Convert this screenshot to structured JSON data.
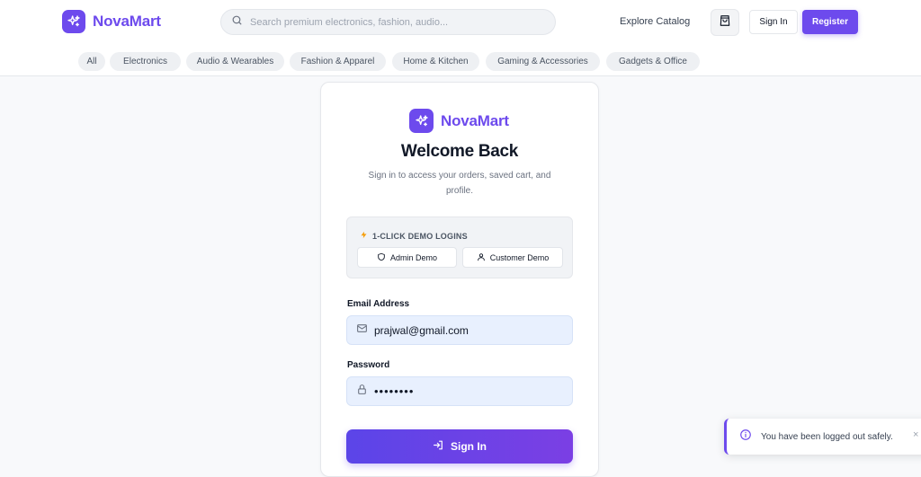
{
  "brand": {
    "name": "NovaMart",
    "color": "#6d4aed",
    "icon": "sparkles-icon"
  },
  "header": {
    "search_placeholder": "Search premium electronics, fashion, audio...",
    "explore_label": "Explore Catalog",
    "cart_icon": "shopping-bag-icon",
    "signin_label": "Sign In",
    "register_label": "Register"
  },
  "categories": [
    "All",
    "Electronics",
    "Audio & Wearables",
    "Fashion & Apparel",
    "Home & Kitchen",
    "Gaming & Accessories",
    "Gadgets & Office"
  ],
  "login": {
    "brand": "NovaMart",
    "title": "Welcome Back",
    "subtitle": "Sign in to access your orders, saved cart, and profile.",
    "demo": {
      "title": "1-CLICK DEMO LOGINS",
      "admin_label": "Admin Demo",
      "customer_label": "Customer Demo"
    },
    "email_label": "Email Address",
    "email_value": "prajwal@gmail.com",
    "password_label": "Password",
    "password_value": "12345678",
    "submit_label": "Sign In"
  },
  "toast": {
    "message": "You have been logged out safely.",
    "icon": "info-icon",
    "close": "×"
  }
}
